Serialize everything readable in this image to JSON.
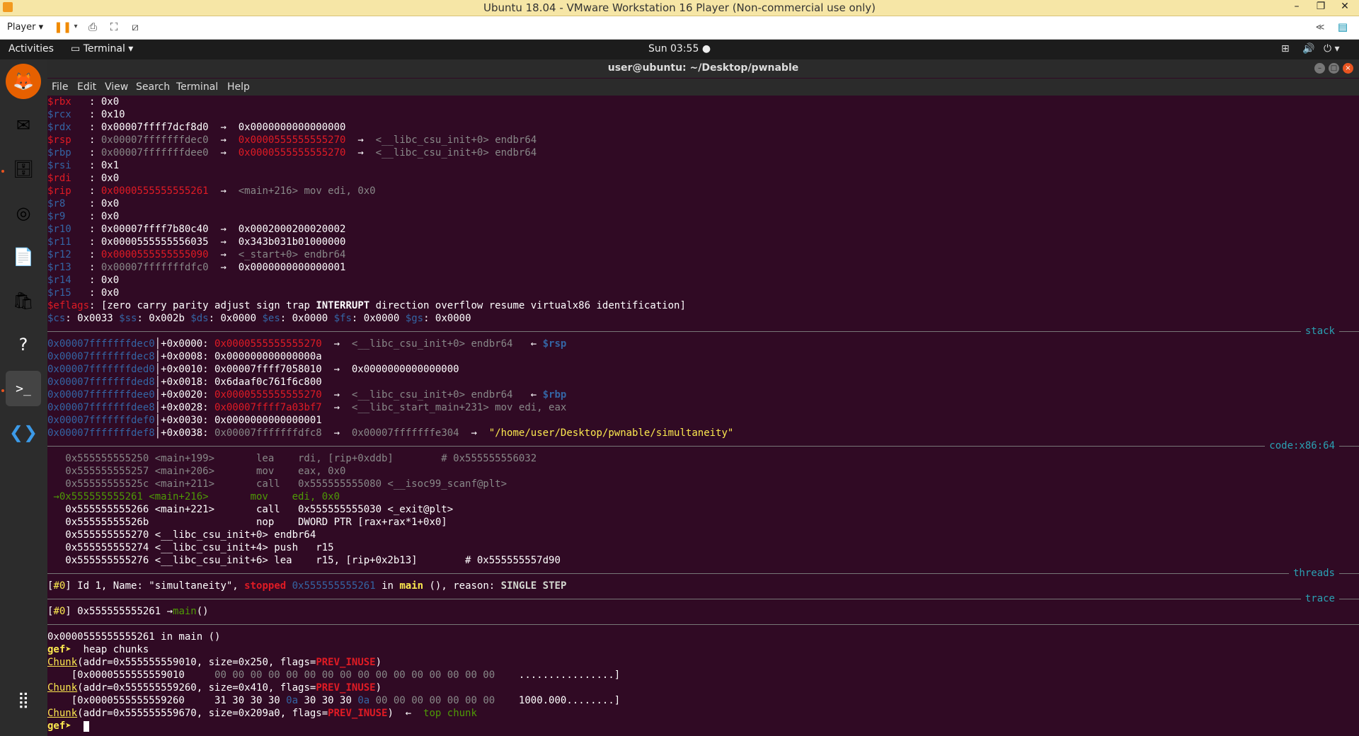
{
  "vm": {
    "title": "Ubuntu 18.04 - VMware Workstation 16 Player (Non-commercial use only)",
    "player_menu": "Player ▾",
    "min": "–",
    "max": "❐",
    "close": "✕"
  },
  "gnome": {
    "activities": "Activities",
    "app_menu": "Terminal ▾",
    "clock": "Sun 03:55 ●"
  },
  "terminal": {
    "title": "user@ubuntu: ~/Desktop/pwnable",
    "menu": [
      "File",
      "Edit",
      "View",
      "Search",
      "Terminal",
      "Help"
    ]
  },
  "dock_icons": [
    "firefox-icon",
    "thunderbird-icon",
    "files-icon",
    "rhythmbox-icon",
    "writer-icon",
    "software-icon",
    "help-icon",
    "terminal-icon",
    "vscode-icon",
    "apps-grid-icon"
  ],
  "colors": {
    "terminal_bg": "#300a24",
    "section_label": "#2aa1b3",
    "ubuntu_orange": "#e95420"
  },
  "lines": [
    {
      "k": "line",
      "s": [
        {
          "t": "$rbx   ",
          "c": "rd"
        },
        {
          "t": ": 0x0",
          "c": "wh"
        }
      ]
    },
    {
      "k": "line",
      "s": [
        {
          "t": "$rcx   ",
          "c": "bl"
        },
        {
          "t": ": 0x10",
          "c": "wh"
        }
      ]
    },
    {
      "k": "line",
      "s": [
        {
          "t": "$rdx   ",
          "c": "bl"
        },
        {
          "t": ": 0x00007ffff7dcf8d0  →  0x0000000000000000",
          "c": "wh"
        }
      ]
    },
    {
      "k": "line",
      "s": [
        {
          "t": "$rsp   ",
          "c": "rd"
        },
        {
          "t": ": ",
          "c": "wh"
        },
        {
          "t": "0x00007fffffffdec0",
          "c": "dg"
        },
        {
          "t": "  →  ",
          "c": "wh"
        },
        {
          "t": "0x0000555555555270",
          "c": "rd"
        },
        {
          "t": "  →  ",
          "c": "wh"
        },
        {
          "t": "<__libc_csu_init+0> endbr64",
          "c": "dg"
        }
      ]
    },
    {
      "k": "line",
      "s": [
        {
          "t": "$rbp   ",
          "c": "bl"
        },
        {
          "t": ": ",
          "c": "wh"
        },
        {
          "t": "0x00007fffffffdee0",
          "c": "dg"
        },
        {
          "t": "  →  ",
          "c": "wh"
        },
        {
          "t": "0x0000555555555270",
          "c": "rd"
        },
        {
          "t": "  →  ",
          "c": "wh"
        },
        {
          "t": "<__libc_csu_init+0> endbr64",
          "c": "dg"
        }
      ]
    },
    {
      "k": "line",
      "s": [
        {
          "t": "$rsi   ",
          "c": "bl"
        },
        {
          "t": ": 0x1",
          "c": "wh"
        }
      ]
    },
    {
      "k": "line",
      "s": [
        {
          "t": "$rdi   ",
          "c": "rd"
        },
        {
          "t": ": 0x0",
          "c": "wh"
        }
      ]
    },
    {
      "k": "line",
      "s": [
        {
          "t": "$rip   ",
          "c": "rd"
        },
        {
          "t": ": ",
          "c": "wh"
        },
        {
          "t": "0x0000555555555261",
          "c": "rd"
        },
        {
          "t": "  →  ",
          "c": "wh"
        },
        {
          "t": "<main+216> mov edi, 0x0",
          "c": "dg"
        }
      ]
    },
    {
      "k": "line",
      "s": [
        {
          "t": "$r8    ",
          "c": "bl"
        },
        {
          "t": ": 0x0",
          "c": "wh"
        }
      ]
    },
    {
      "k": "line",
      "s": [
        {
          "t": "$r9    ",
          "c": "bl"
        },
        {
          "t": ": 0x0",
          "c": "wh"
        }
      ]
    },
    {
      "k": "line",
      "s": [
        {
          "t": "$r10   ",
          "c": "bl"
        },
        {
          "t": ": 0x00007ffff7b80c40  →  0x0002000200020002",
          "c": "wh"
        }
      ]
    },
    {
      "k": "line",
      "s": [
        {
          "t": "$r11   ",
          "c": "bl"
        },
        {
          "t": ": 0x0000555555556035  →  0x343b031b01000000",
          "c": "wh"
        }
      ]
    },
    {
      "k": "line",
      "s": [
        {
          "t": "$r12   ",
          "c": "bl"
        },
        {
          "t": ": ",
          "c": "wh"
        },
        {
          "t": "0x0000555555555090",
          "c": "rd"
        },
        {
          "t": "  →  ",
          "c": "wh"
        },
        {
          "t": "<_start+0> endbr64",
          "c": "dg"
        }
      ]
    },
    {
      "k": "line",
      "s": [
        {
          "t": "$r13   ",
          "c": "bl"
        },
        {
          "t": ": ",
          "c": "wh"
        },
        {
          "t": "0x00007fffffffdfc0",
          "c": "dg"
        },
        {
          "t": "  →  0x0000000000000001",
          "c": "wh"
        }
      ]
    },
    {
      "k": "line",
      "s": [
        {
          "t": "$r14   ",
          "c": "bl"
        },
        {
          "t": ": 0x0",
          "c": "wh"
        }
      ]
    },
    {
      "k": "line",
      "s": [
        {
          "t": "$r15   ",
          "c": "bl"
        },
        {
          "t": ": 0x0",
          "c": "wh"
        }
      ]
    },
    {
      "k": "line",
      "s": [
        {
          "t": "$eflags",
          "c": "rd"
        },
        {
          "t": ": [zero carry parity adjust sign trap ",
          "c": "wh"
        },
        {
          "t": "INTERRUPT",
          "c": "wh",
          "b": true
        },
        {
          "t": " direction overflow resume virtualx86 identification]",
          "c": "wh"
        }
      ]
    },
    {
      "k": "line",
      "s": [
        {
          "t": "$cs",
          "c": "bl"
        },
        {
          "t": ": 0x0033 ",
          "c": "wh"
        },
        {
          "t": "$ss",
          "c": "bl"
        },
        {
          "t": ": 0x002b ",
          "c": "wh"
        },
        {
          "t": "$ds",
          "c": "bl"
        },
        {
          "t": ": 0x0000 ",
          "c": "wh"
        },
        {
          "t": "$es",
          "c": "bl"
        },
        {
          "t": ": 0x0000 ",
          "c": "wh"
        },
        {
          "t": "$fs",
          "c": "bl"
        },
        {
          "t": ": 0x0000 ",
          "c": "wh"
        },
        {
          "t": "$gs",
          "c": "bl"
        },
        {
          "t": ": 0x0000",
          "c": "wh"
        }
      ]
    },
    {
      "k": "sect",
      "label": "stack"
    },
    {
      "k": "line",
      "s": [
        {
          "t": "0x00007fffffffdec0",
          "c": "bl"
        },
        {
          "t": "│+0x0000: ",
          "c": "wh"
        },
        {
          "t": "0x0000555555555270",
          "c": "rd"
        },
        {
          "t": "  →  ",
          "c": "wh"
        },
        {
          "t": "<__libc_csu_init+0> endbr64",
          "c": "dg"
        },
        {
          "t": "   ← ",
          "c": "wh"
        },
        {
          "t": "$rsp",
          "c": "bl",
          "b": true
        }
      ]
    },
    {
      "k": "line",
      "s": [
        {
          "t": "0x00007fffffffdec8",
          "c": "bl"
        },
        {
          "t": "│+0x0008: 0x000000000000000a",
          "c": "wh"
        }
      ]
    },
    {
      "k": "line",
      "s": [
        {
          "t": "0x00007fffffffded0",
          "c": "bl"
        },
        {
          "t": "│+0x0010: 0x00007ffff7058010  →  0x0000000000000000",
          "c": "wh"
        }
      ]
    },
    {
      "k": "line",
      "s": [
        {
          "t": "0x00007fffffffded8",
          "c": "bl"
        },
        {
          "t": "│+0x0018: 0x6daaf0c761f6c800",
          "c": "wh"
        }
      ]
    },
    {
      "k": "line",
      "s": [
        {
          "t": "0x00007fffffffdee0",
          "c": "bl"
        },
        {
          "t": "│+0x0020: ",
          "c": "wh"
        },
        {
          "t": "0x0000555555555270",
          "c": "rd"
        },
        {
          "t": "  →  ",
          "c": "wh"
        },
        {
          "t": "<__libc_csu_init+0> endbr64",
          "c": "dg"
        },
        {
          "t": "   ← ",
          "c": "wh"
        },
        {
          "t": "$rbp",
          "c": "bl",
          "b": true
        }
      ]
    },
    {
      "k": "line",
      "s": [
        {
          "t": "0x00007fffffffdee8",
          "c": "bl"
        },
        {
          "t": "│+0x0028: ",
          "c": "wh"
        },
        {
          "t": "0x00007ffff7a03bf7",
          "c": "rd"
        },
        {
          "t": "  →  ",
          "c": "wh"
        },
        {
          "t": "<__libc_start_main+231> mov edi, eax",
          "c": "dg"
        }
      ]
    },
    {
      "k": "line",
      "s": [
        {
          "t": "0x00007fffffffdef0",
          "c": "bl"
        },
        {
          "t": "│+0x0030: 0x0000000000000001",
          "c": "wh"
        }
      ]
    },
    {
      "k": "line",
      "s": [
        {
          "t": "0x00007fffffffdef8",
          "c": "bl"
        },
        {
          "t": "│+0x0038: ",
          "c": "wh"
        },
        {
          "t": "0x00007fffffffdfc8",
          "c": "dg"
        },
        {
          "t": "  →  ",
          "c": "wh"
        },
        {
          "t": "0x00007fffffffe304",
          "c": "dg"
        },
        {
          "t": "  →  ",
          "c": "wh"
        },
        {
          "t": "\"/home/user/Desktop/pwnable/simultaneity\"",
          "c": "yl"
        }
      ]
    },
    {
      "k": "sect",
      "label": "code:x86:64"
    },
    {
      "k": "line",
      "s": [
        {
          "t": "   0x555555555250 <main+199>       lea    rdi, [rip+0xddb]        # 0x555555556032",
          "c": "dg"
        }
      ]
    },
    {
      "k": "line",
      "s": [
        {
          "t": "   0x555555555257 <main+206>       mov    eax, 0x0",
          "c": "dg"
        }
      ]
    },
    {
      "k": "line",
      "s": [
        {
          "t": "   0x55555555525c <main+211>       call   0x555555555080 <__isoc99_scanf@plt>",
          "c": "dg"
        }
      ]
    },
    {
      "k": "line",
      "s": [
        {
          "t": " →0x555555555261 <main+216>       mov    edi, 0x0",
          "c": "gr"
        }
      ]
    },
    {
      "k": "line",
      "s": [
        {
          "t": "   0x555555555266 <main+221>       call   0x555555555030 <_exit@plt>",
          "c": "wh"
        }
      ]
    },
    {
      "k": "line",
      "s": [
        {
          "t": "   0x55555555526b                  nop    DWORD PTR [rax+rax*1+0x0]",
          "c": "wh"
        }
      ]
    },
    {
      "k": "line",
      "s": [
        {
          "t": "   0x555555555270 <__libc_csu_init+0> endbr64",
          "c": "wh"
        }
      ]
    },
    {
      "k": "line",
      "s": [
        {
          "t": "   0x555555555274 <__libc_csu_init+4> push   r15",
          "c": "wh"
        }
      ]
    },
    {
      "k": "line",
      "s": [
        {
          "t": "   0x555555555276 <__libc_csu_init+6> lea    r15, [rip+0x2b13]        # 0x555555557d90",
          "c": "wh"
        }
      ]
    },
    {
      "k": "sect",
      "label": "threads"
    },
    {
      "k": "line",
      "s": [
        {
          "t": "[",
          "c": "wh"
        },
        {
          "t": "#0",
          "c": "yl"
        },
        {
          "t": "] Id 1, Name: \"simultaneity\", ",
          "c": "wh"
        },
        {
          "t": "stopped",
          "c": "rd",
          "b": true
        },
        {
          "t": " ",
          "c": "wh"
        },
        {
          "t": "0x555555555261",
          "c": "bl"
        },
        {
          "t": " in ",
          "c": "wh"
        },
        {
          "t": "main",
          "c": "yl",
          "b": true
        },
        {
          "t": " (), reason: ",
          "c": "wh"
        },
        {
          "t": "SINGLE STEP",
          "c": "mg",
          "b": true
        }
      ]
    },
    {
      "k": "sect",
      "label": "trace"
    },
    {
      "k": "line",
      "s": [
        {
          "t": "[",
          "c": "wh"
        },
        {
          "t": "#0",
          "c": "yl"
        },
        {
          "t": "] 0x555555555261 →",
          "c": "wh"
        },
        {
          "t": "main",
          "c": "gr"
        },
        {
          "t": "()",
          "c": "wh"
        }
      ]
    },
    {
      "k": "sect",
      "label": ""
    },
    {
      "k": "line",
      "s": [
        {
          "t": "0x0000555555555261 in main ()",
          "c": "wh"
        }
      ]
    },
    {
      "k": "line",
      "s": [
        {
          "t": "gef➤  ",
          "c": "yl",
          "b": true
        },
        {
          "t": "heap chunks",
          "c": "wh"
        }
      ]
    },
    {
      "k": "line",
      "s": [
        {
          "t": "Chunk",
          "c": "yl",
          "u": true
        },
        {
          "t": "(addr=0x555555559010, size=0x250, flags=",
          "c": "wh"
        },
        {
          "t": "PREV_INUSE",
          "c": "rd",
          "b": true
        },
        {
          "t": ")",
          "c": "wh"
        }
      ]
    },
    {
      "k": "line",
      "s": [
        {
          "t": "    [0x0000555555559010     ",
          "c": "wh"
        },
        {
          "t": "00 00 00 00 00 00 00 00 00 00 00 00 00 00 00 00",
          "c": "dg"
        },
        {
          "t": "    ................]",
          "c": "wh"
        }
      ]
    },
    {
      "k": "line",
      "s": [
        {
          "t": "Chunk",
          "c": "yl",
          "u": true
        },
        {
          "t": "(addr=0x555555559260, size=0x410, flags=",
          "c": "wh"
        },
        {
          "t": "PREV_INUSE",
          "c": "rd",
          "b": true
        },
        {
          "t": ")",
          "c": "wh"
        }
      ]
    },
    {
      "k": "line",
      "s": [
        {
          "t": "    [0x0000555555559260     ",
          "c": "wh"
        },
        {
          "t": "31 30 30 30 ",
          "c": "wh"
        },
        {
          "t": "0a",
          "c": "bl"
        },
        {
          "t": " 30 30 30 ",
          "c": "wh"
        },
        {
          "t": "0a",
          "c": "bl"
        },
        {
          "t": " 00 00 00 00 00 00 00",
          "c": "dg"
        },
        {
          "t": "    1000.000........]",
          "c": "wh"
        }
      ]
    },
    {
      "k": "line",
      "s": [
        {
          "t": "Chunk",
          "c": "yl",
          "u": true
        },
        {
          "t": "(addr=0x555555559670, size=0x209a0, flags=",
          "c": "wh"
        },
        {
          "t": "PREV_INUSE",
          "c": "rd",
          "b": true
        },
        {
          "t": ")  ←  ",
          "c": "wh"
        },
        {
          "t": "top chunk",
          "c": "gr"
        }
      ]
    },
    {
      "k": "prompt",
      "s": [
        {
          "t": "gef➤  ",
          "c": "yl",
          "b": true
        }
      ]
    }
  ]
}
